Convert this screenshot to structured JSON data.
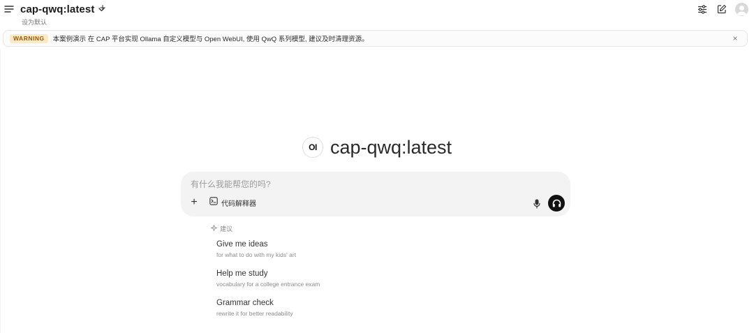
{
  "header": {
    "model_name": "cap-qwq:latest",
    "add_model": "+",
    "set_default": "设为默认"
  },
  "banner": {
    "badge": "WARNING",
    "message": "本案例演示 在 CAP 平台实现 Ollama 自定义模型与 Open WebUI, 使用 QwQ 系列模型, 建议及时清理资源。",
    "close": "×",
    "badge_color": "#fde9c6"
  },
  "hero": {
    "logo_text": "OI",
    "title": "cap-qwq:latest"
  },
  "composer": {
    "placeholder": "有什么我能帮您的吗?",
    "value": "",
    "plus": "+",
    "code_interpreter_label": "代码解释器"
  },
  "suggestions": {
    "header": "建议",
    "items": [
      {
        "title": "Give me ideas",
        "subtitle": "for what to do with my kids' art"
      },
      {
        "title": "Help me study",
        "subtitle": "vocabulary for a college entrance exam"
      },
      {
        "title": "Grammar check",
        "subtitle": "rewrite it for better readability"
      }
    ]
  },
  "icons": {
    "menu": "menu-icon",
    "chevron": "chevron-down-icon",
    "controls": "sliders-icon",
    "new_chat": "edit-icon",
    "avatar": "user-avatar-icon",
    "code": "terminal-icon",
    "mic": "microphone-icon",
    "voice": "headphones-icon",
    "sparkle": "sparkle-icon"
  },
  "colors": {
    "accent": "#111111",
    "composer_bg": "#f3f3f3"
  }
}
